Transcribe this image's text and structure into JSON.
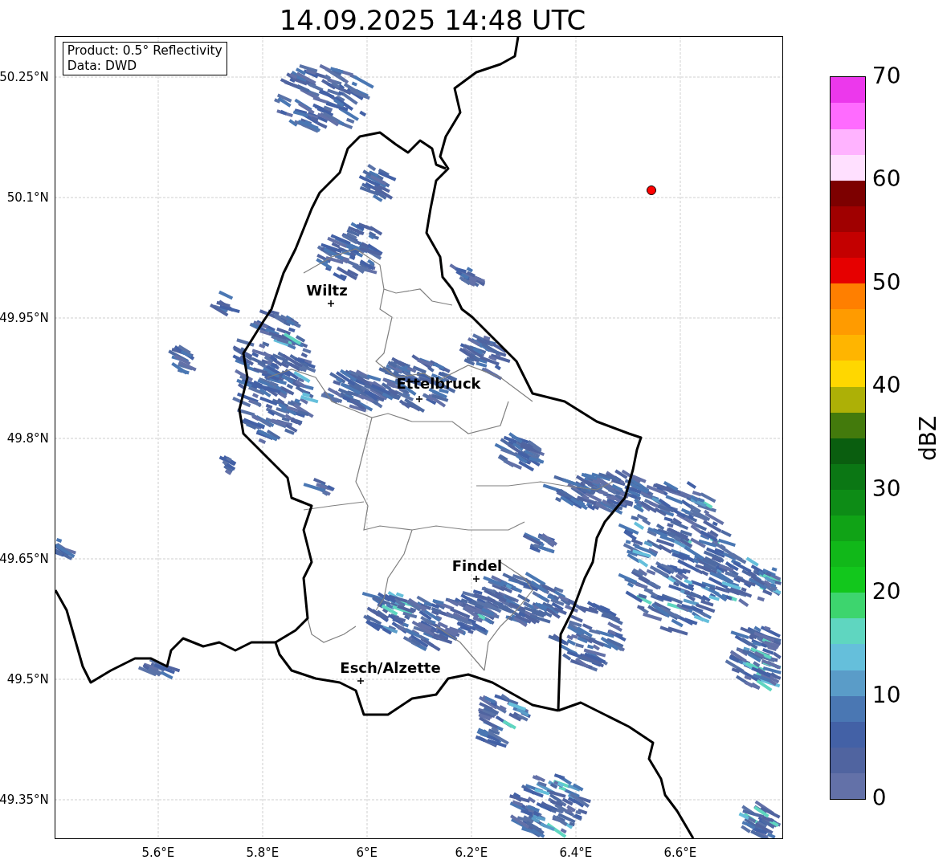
{
  "title": "14.09.2025 14:48 UTC",
  "info_box": [
    "Product: 0.5° Reflectivity",
    "Data: DWD"
  ],
  "yticks": [
    "50.25°N",
    "50.1°N",
    "49.95°N",
    "49.8°N",
    "49.65°N",
    "49.5°N",
    "49.35°N"
  ],
  "xticks": [
    "5.6°E",
    "5.8°E",
    "6°E",
    "6.2°E",
    "6.4°E",
    "6.6°E"
  ],
  "cities": [
    {
      "name": "Wiltz"
    },
    {
      "name": "Ettelbruck"
    },
    {
      "name": "Findel"
    },
    {
      "name": "Esch/Alzette"
    }
  ],
  "colorbar": {
    "label": "dBZ",
    "ticks": [
      "70",
      "60",
      "50",
      "40",
      "30",
      "20",
      "10",
      "0"
    ],
    "bands": [
      {
        "color": "#6371a8"
      },
      {
        "color": "#5064a0"
      },
      {
        "color": "#4361a6"
      },
      {
        "color": "#4a77b3"
      },
      {
        "color": "#5a9cc8"
      },
      {
        "color": "#65bfdb"
      },
      {
        "color": "#5fd6c0"
      },
      {
        "color": "#3dd56e"
      },
      {
        "color": "#12c71c"
      },
      {
        "color": "#11b819"
      },
      {
        "color": "#10a316"
      },
      {
        "color": "#0d8c16"
      },
      {
        "color": "#0b7714"
      },
      {
        "color": "#0a5e0f"
      },
      {
        "color": "#437a0c"
      },
      {
        "color": "#adb006"
      },
      {
        "color": "#ffd700"
      },
      {
        "color": "#ffb500"
      },
      {
        "color": "#ff9b00"
      },
      {
        "color": "#ff7f00"
      },
      {
        "color": "#e60000"
      },
      {
        "color": "#c40000"
      },
      {
        "color": "#a00000"
      },
      {
        "color": "#7d0000"
      },
      {
        "color": "#ffe0ff"
      },
      {
        "color": "#ffb3ff"
      },
      {
        "color": "#ff6bff"
      },
      {
        "color": "#ec38ec"
      }
    ]
  }
}
